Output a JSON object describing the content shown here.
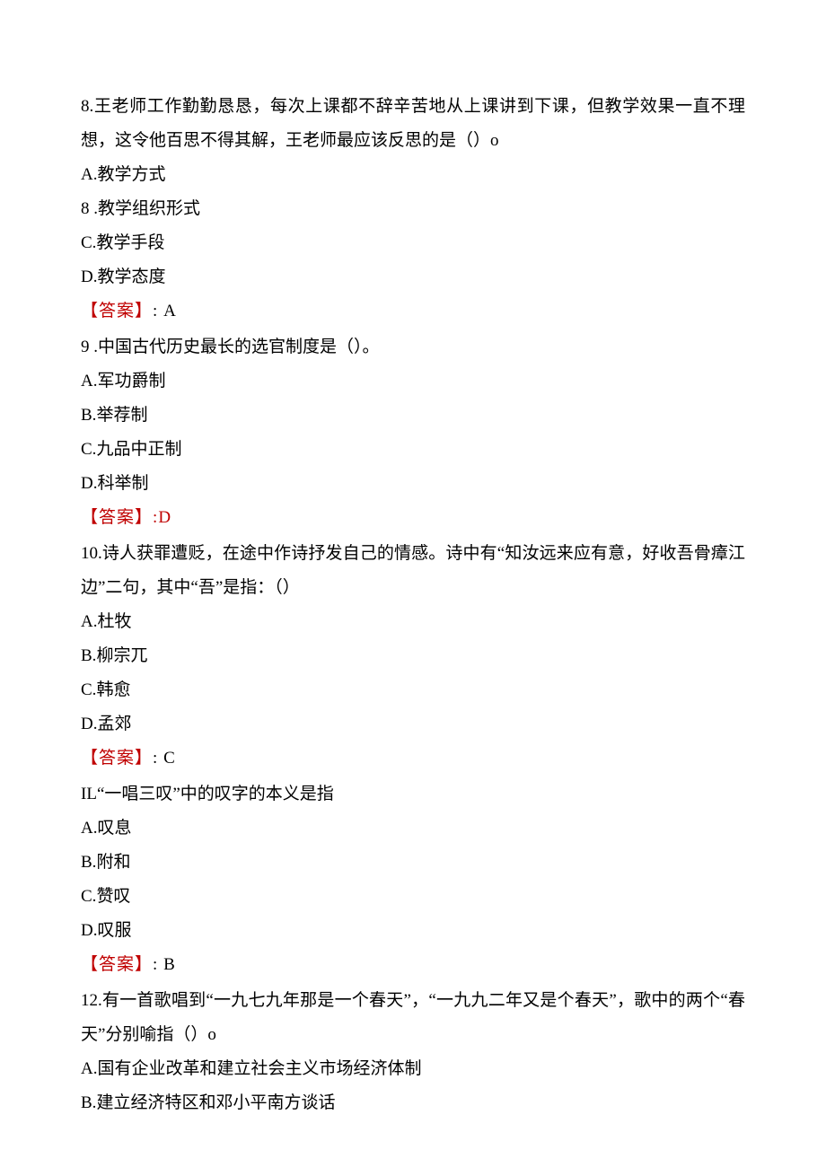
{
  "questions": [
    {
      "number": "8.",
      "text": "王老师工作勤勤恳恳，每次上课都不辞辛苦地从上课讲到下课，但教学效果一直不理想，这令他百思不得其解，王老师最应该反思的是（）o",
      "options": [
        {
          "label": "A.",
          "text": "教学方式"
        },
        {
          "label": "8 .",
          "text": "教学组织形式"
        },
        {
          "label": "C.",
          "text": "教学手段"
        },
        {
          "label": "D.",
          "text": "教学态度"
        }
      ],
      "answer_label": "答案",
      "answer_value": ": A",
      "answer_style": "black"
    },
    {
      "number": "9 .",
      "text": "中国古代历史最长的选官制度是（）。",
      "options": [
        {
          "label": "A.",
          "text": "军功爵制"
        },
        {
          "label": "B.",
          "text": "举荐制"
        },
        {
          "label": "C.",
          "text": "九品中正制"
        },
        {
          "label": "D.",
          "text": "科举制"
        }
      ],
      "answer_label": "答案",
      "answer_value": ":D",
      "answer_style": "red"
    },
    {
      "number": "10.",
      "text": "诗人获罪遭贬，在途中作诗抒发自己的情感。诗中有“知汝远来应有意，好收吾骨瘴江边”二句，其中“吾”是指：（）",
      "options": [
        {
          "label": "A.",
          "text": "杜牧"
        },
        {
          "label": "B.",
          "text": "柳宗兀"
        },
        {
          "label": "C.",
          "text": "韩愈"
        },
        {
          "label": "D.",
          "text": "孟郊"
        }
      ],
      "answer_label": "答案",
      "answer_value": ": C",
      "answer_style": "black"
    },
    {
      "number": "IL",
      "text": "“一唱三叹”中的叹字的本义是指",
      "options": [
        {
          "label": "A.",
          "text": "叹息"
        },
        {
          "label": "B.",
          "text": "附和"
        },
        {
          "label": "C.",
          "text": "赞叹"
        },
        {
          "label": "D.",
          "text": "叹服"
        }
      ],
      "answer_label": "答案",
      "answer_value": ": B",
      "answer_style": "black"
    },
    {
      "number": "12.",
      "text": "有一首歌唱到“一九七九年那是一个春天”，“一九九二年又是个春天”，歌中的两个“春天”分别喻指（）o",
      "options": [
        {
          "label": "A.",
          "text": "国有企业改革和建立社会主义市场经济体制"
        },
        {
          "label": "B.",
          "text": "建立经济特区和邓小平南方谈话"
        }
      ],
      "answer_label": "",
      "answer_value": "",
      "answer_style": ""
    }
  ]
}
